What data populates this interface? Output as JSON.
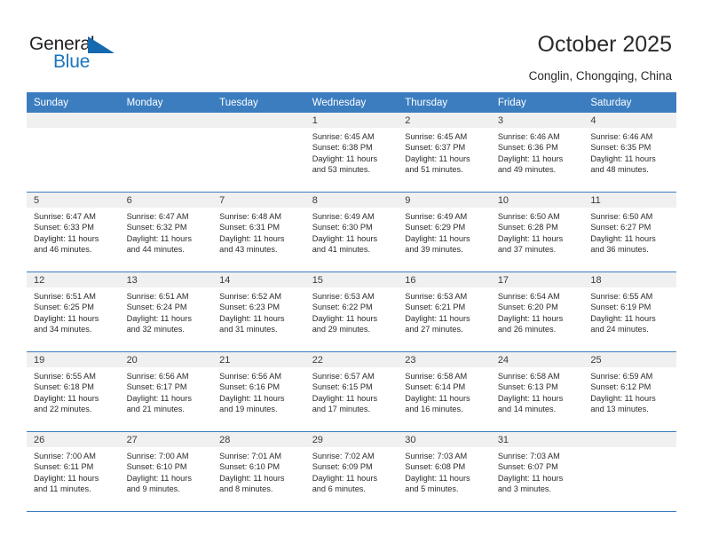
{
  "brand": {
    "line1": "General",
    "line2": "Blue",
    "triangle_color": "#1469b0",
    "line2_color": "#1b75bc"
  },
  "header": {
    "title": "October 2025",
    "subtitle": "Conglin, Chongqing, China"
  },
  "theme": {
    "header_bg": "#3b7dbf",
    "header_text": "#ffffff",
    "daynum_band_bg": "#f0f0f0",
    "row_rule": "#3b7dbf",
    "body_text": "#2b2b2b"
  },
  "weekday_headers": [
    "Sunday",
    "Monday",
    "Tuesday",
    "Wednesday",
    "Thursday",
    "Friday",
    "Saturday"
  ],
  "labels": {
    "sunrise_prefix": "Sunrise:",
    "sunset_prefix": "Sunset:",
    "daylight_prefix": "Daylight:"
  },
  "weeks": [
    [
      {
        "day": "",
        "blank": true
      },
      {
        "day": "",
        "blank": true
      },
      {
        "day": "",
        "blank": true
      },
      {
        "day": "1",
        "sunrise": "Sunrise: 6:45 AM",
        "sunset": "Sunset: 6:38 PM",
        "daylight_line1": "Daylight: 11 hours",
        "daylight_line2": "and 53 minutes."
      },
      {
        "day": "2",
        "sunrise": "Sunrise: 6:45 AM",
        "sunset": "Sunset: 6:37 PM",
        "daylight_line1": "Daylight: 11 hours",
        "daylight_line2": "and 51 minutes."
      },
      {
        "day": "3",
        "sunrise": "Sunrise: 6:46 AM",
        "sunset": "Sunset: 6:36 PM",
        "daylight_line1": "Daylight: 11 hours",
        "daylight_line2": "and 49 minutes."
      },
      {
        "day": "4",
        "sunrise": "Sunrise: 6:46 AM",
        "sunset": "Sunset: 6:35 PM",
        "daylight_line1": "Daylight: 11 hours",
        "daylight_line2": "and 48 minutes."
      }
    ],
    [
      {
        "day": "5",
        "sunrise": "Sunrise: 6:47 AM",
        "sunset": "Sunset: 6:33 PM",
        "daylight_line1": "Daylight: 11 hours",
        "daylight_line2": "and 46 minutes."
      },
      {
        "day": "6",
        "sunrise": "Sunrise: 6:47 AM",
        "sunset": "Sunset: 6:32 PM",
        "daylight_line1": "Daylight: 11 hours",
        "daylight_line2": "and 44 minutes."
      },
      {
        "day": "7",
        "sunrise": "Sunrise: 6:48 AM",
        "sunset": "Sunset: 6:31 PM",
        "daylight_line1": "Daylight: 11 hours",
        "daylight_line2": "and 43 minutes."
      },
      {
        "day": "8",
        "sunrise": "Sunrise: 6:49 AM",
        "sunset": "Sunset: 6:30 PM",
        "daylight_line1": "Daylight: 11 hours",
        "daylight_line2": "and 41 minutes."
      },
      {
        "day": "9",
        "sunrise": "Sunrise: 6:49 AM",
        "sunset": "Sunset: 6:29 PM",
        "daylight_line1": "Daylight: 11 hours",
        "daylight_line2": "and 39 minutes."
      },
      {
        "day": "10",
        "sunrise": "Sunrise: 6:50 AM",
        "sunset": "Sunset: 6:28 PM",
        "daylight_line1": "Daylight: 11 hours",
        "daylight_line2": "and 37 minutes."
      },
      {
        "day": "11",
        "sunrise": "Sunrise: 6:50 AM",
        "sunset": "Sunset: 6:27 PM",
        "daylight_line1": "Daylight: 11 hours",
        "daylight_line2": "and 36 minutes."
      }
    ],
    [
      {
        "day": "12",
        "sunrise": "Sunrise: 6:51 AM",
        "sunset": "Sunset: 6:25 PM",
        "daylight_line1": "Daylight: 11 hours",
        "daylight_line2": "and 34 minutes."
      },
      {
        "day": "13",
        "sunrise": "Sunrise: 6:51 AM",
        "sunset": "Sunset: 6:24 PM",
        "daylight_line1": "Daylight: 11 hours",
        "daylight_line2": "and 32 minutes."
      },
      {
        "day": "14",
        "sunrise": "Sunrise: 6:52 AM",
        "sunset": "Sunset: 6:23 PM",
        "daylight_line1": "Daylight: 11 hours",
        "daylight_line2": "and 31 minutes."
      },
      {
        "day": "15",
        "sunrise": "Sunrise: 6:53 AM",
        "sunset": "Sunset: 6:22 PM",
        "daylight_line1": "Daylight: 11 hours",
        "daylight_line2": "and 29 minutes."
      },
      {
        "day": "16",
        "sunrise": "Sunrise: 6:53 AM",
        "sunset": "Sunset: 6:21 PM",
        "daylight_line1": "Daylight: 11 hours",
        "daylight_line2": "and 27 minutes."
      },
      {
        "day": "17",
        "sunrise": "Sunrise: 6:54 AM",
        "sunset": "Sunset: 6:20 PM",
        "daylight_line1": "Daylight: 11 hours",
        "daylight_line2": "and 26 minutes."
      },
      {
        "day": "18",
        "sunrise": "Sunrise: 6:55 AM",
        "sunset": "Sunset: 6:19 PM",
        "daylight_line1": "Daylight: 11 hours",
        "daylight_line2": "and 24 minutes."
      }
    ],
    [
      {
        "day": "19",
        "sunrise": "Sunrise: 6:55 AM",
        "sunset": "Sunset: 6:18 PM",
        "daylight_line1": "Daylight: 11 hours",
        "daylight_line2": "and 22 minutes."
      },
      {
        "day": "20",
        "sunrise": "Sunrise: 6:56 AM",
        "sunset": "Sunset: 6:17 PM",
        "daylight_line1": "Daylight: 11 hours",
        "daylight_line2": "and 21 minutes."
      },
      {
        "day": "21",
        "sunrise": "Sunrise: 6:56 AM",
        "sunset": "Sunset: 6:16 PM",
        "daylight_line1": "Daylight: 11 hours",
        "daylight_line2": "and 19 minutes."
      },
      {
        "day": "22",
        "sunrise": "Sunrise: 6:57 AM",
        "sunset": "Sunset: 6:15 PM",
        "daylight_line1": "Daylight: 11 hours",
        "daylight_line2": "and 17 minutes."
      },
      {
        "day": "23",
        "sunrise": "Sunrise: 6:58 AM",
        "sunset": "Sunset: 6:14 PM",
        "daylight_line1": "Daylight: 11 hours",
        "daylight_line2": "and 16 minutes."
      },
      {
        "day": "24",
        "sunrise": "Sunrise: 6:58 AM",
        "sunset": "Sunset: 6:13 PM",
        "daylight_line1": "Daylight: 11 hours",
        "daylight_line2": "and 14 minutes."
      },
      {
        "day": "25",
        "sunrise": "Sunrise: 6:59 AM",
        "sunset": "Sunset: 6:12 PM",
        "daylight_line1": "Daylight: 11 hours",
        "daylight_line2": "and 13 minutes."
      }
    ],
    [
      {
        "day": "26",
        "sunrise": "Sunrise: 7:00 AM",
        "sunset": "Sunset: 6:11 PM",
        "daylight_line1": "Daylight: 11 hours",
        "daylight_line2": "and 11 minutes."
      },
      {
        "day": "27",
        "sunrise": "Sunrise: 7:00 AM",
        "sunset": "Sunset: 6:10 PM",
        "daylight_line1": "Daylight: 11 hours",
        "daylight_line2": "and 9 minutes."
      },
      {
        "day": "28",
        "sunrise": "Sunrise: 7:01 AM",
        "sunset": "Sunset: 6:10 PM",
        "daylight_line1": "Daylight: 11 hours",
        "daylight_line2": "and 8 minutes."
      },
      {
        "day": "29",
        "sunrise": "Sunrise: 7:02 AM",
        "sunset": "Sunset: 6:09 PM",
        "daylight_line1": "Daylight: 11 hours",
        "daylight_line2": "and 6 minutes."
      },
      {
        "day": "30",
        "sunrise": "Sunrise: 7:03 AM",
        "sunset": "Sunset: 6:08 PM",
        "daylight_line1": "Daylight: 11 hours",
        "daylight_line2": "and 5 minutes."
      },
      {
        "day": "31",
        "sunrise": "Sunrise: 7:03 AM",
        "sunset": "Sunset: 6:07 PM",
        "daylight_line1": "Daylight: 11 hours",
        "daylight_line2": "and 3 minutes."
      },
      {
        "day": "",
        "blank": true
      }
    ]
  ]
}
